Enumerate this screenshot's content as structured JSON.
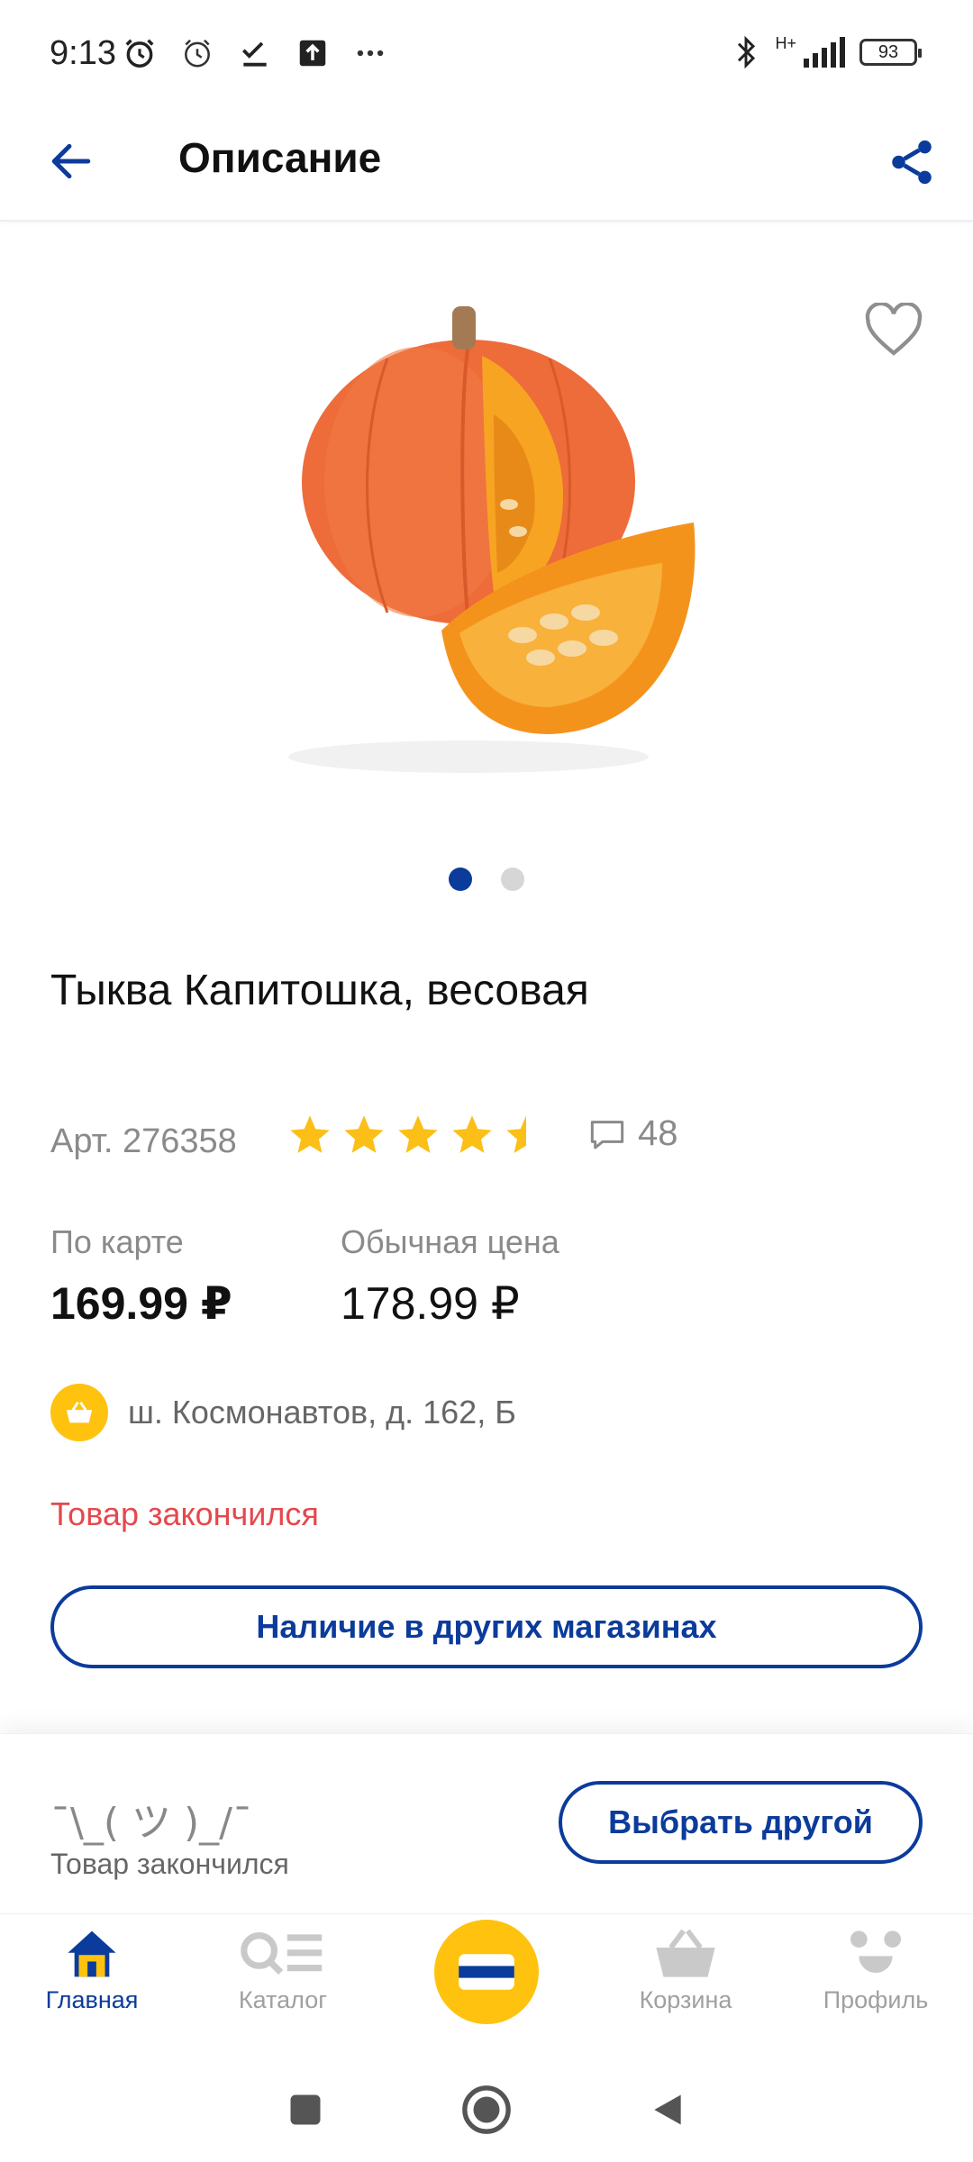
{
  "status_bar": {
    "time": "9:13",
    "network": "H+",
    "battery": "93"
  },
  "header": {
    "title": "Описание",
    "back_icon": "arrow-left-icon",
    "share_icon": "share-icon"
  },
  "product": {
    "image_pages": 2,
    "active_image_page": 1,
    "title": "Тыква Капитошка, весовая",
    "article": "Арт. 276358",
    "rating": 4.6,
    "rating_max": 5,
    "reviews_count": "48",
    "card_price_label": "По карте",
    "card_price": "169.99 ₽",
    "regular_price_label": "Обычная цена",
    "regular_price": "178.99 ₽",
    "store_address": "ш. Космонавтов, д. 162, Б",
    "stock_status": "Товар закончился",
    "availability_button": "Наличие в других магазинах"
  },
  "bottom_sheet": {
    "shrug": "¯\\_( ツ )_/¯",
    "status": "Товар закончился",
    "choose_other_button": "Выбрать другой"
  },
  "bottom_nav": {
    "items": [
      {
        "label": "Главная",
        "icon": "home-icon",
        "active": true
      },
      {
        "label": "Каталог",
        "icon": "catalog-search-icon",
        "active": false
      },
      {
        "label": "",
        "icon": "loyalty-card-icon",
        "active": false
      },
      {
        "label": "Корзина",
        "icon": "basket-icon",
        "active": false
      },
      {
        "label": "Профиль",
        "icon": "profile-face-icon",
        "active": false
      }
    ]
  },
  "colors": {
    "brand_blue": "#0b3b9b",
    "brand_yellow": "#ffc20e",
    "star": "#fbbf17",
    "out_of_stock": "#e5484d"
  }
}
